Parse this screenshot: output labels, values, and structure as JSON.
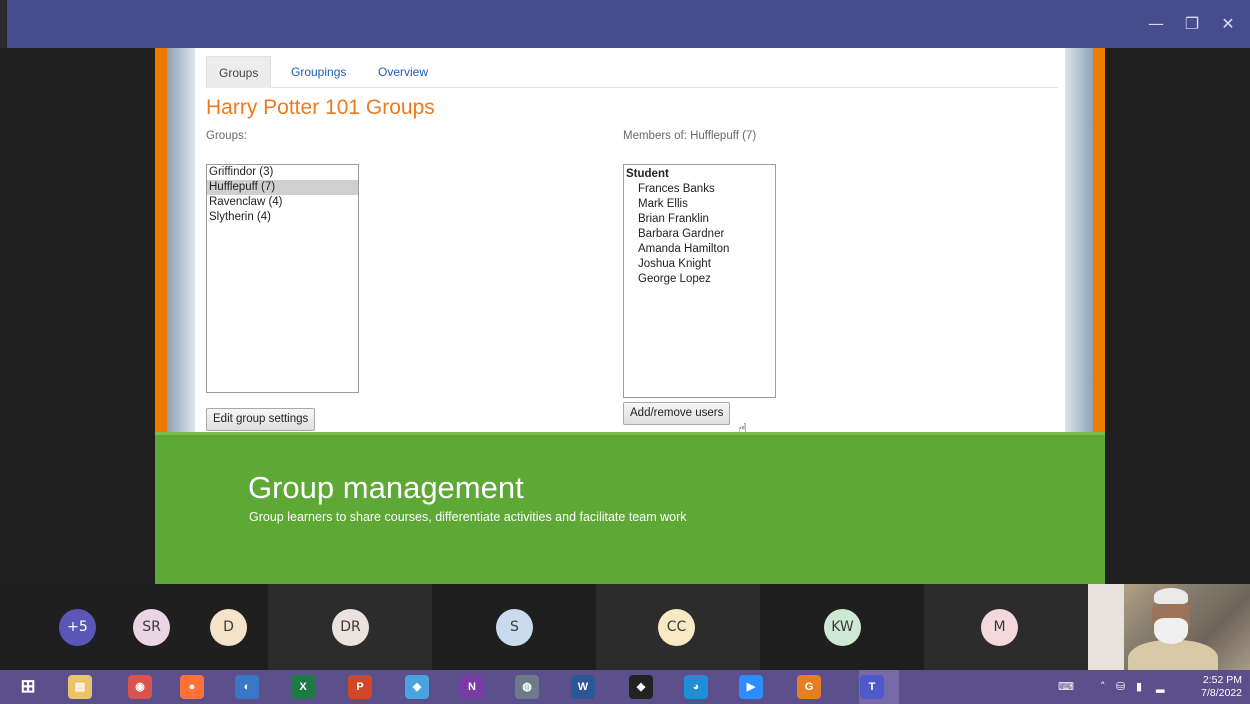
{
  "window": {
    "minimize_glyph": "—",
    "maximize_glyph": "❐",
    "close_glyph": "✕"
  },
  "moodle": {
    "tabs": [
      "Groups",
      "Groupings",
      "Overview"
    ],
    "active_tab": "Groups",
    "page_title": "Harry Potter 101 Groups",
    "groups_label": "Groups:",
    "groups": [
      {
        "label": "Griffindor (3)",
        "selected": false
      },
      {
        "label": "Hufflepuff (7)",
        "selected": true
      },
      {
        "label": "Ravenclaw (4)",
        "selected": false
      },
      {
        "label": "Slytherin (4)",
        "selected": false
      }
    ],
    "members_label": "Members of: Hufflepuff (7)",
    "member_role": "Student",
    "members": [
      "Frances Banks",
      "Mark Ellis",
      "Brian Franklin",
      "Barbara Gardner",
      "Amanda Hamilton",
      "Joshua Knight",
      "George Lopez"
    ],
    "edit_group_button": "Edit group settings",
    "add_remove_button": "Add/remove users"
  },
  "slide": {
    "title": "Group management",
    "subtitle": "Group learners to share courses, differentiate activities and facilitate team work"
  },
  "participants": [
    {
      "initials": "+5",
      "color": "#5a57b8",
      "text_color": "#ffffff"
    },
    {
      "initials": "SR",
      "color": "#ead5e6",
      "text_color": "#3a3a3a"
    },
    {
      "initials": "D",
      "color": "#f4e3c9",
      "text_color": "#3a3a3a"
    },
    {
      "initials": "DR",
      "color": "#ece2dd",
      "text_color": "#3a3a3a"
    },
    {
      "initials": "S",
      "color": "#c9dbef",
      "text_color": "#3a3a3a"
    },
    {
      "initials": "CC",
      "color": "#f6e9c3",
      "text_color": "#3a3a3a"
    },
    {
      "initials": "KW",
      "color": "#cfe8d4",
      "text_color": "#3a3a3a"
    },
    {
      "initials": "M",
      "color": "#f3d8dc",
      "text_color": "#3a3a3a"
    }
  ],
  "taskbar": {
    "apps": [
      {
        "name": "file-explorer-icon",
        "glyph": "▤",
        "color": "#e9c46a"
      },
      {
        "name": "chrome-icon",
        "glyph": "◉",
        "color": "#d9534f"
      },
      {
        "name": "firefox-icon",
        "glyph": "●",
        "color": "#ff7139"
      },
      {
        "name": "media-player-icon",
        "glyph": "◐",
        "color": "#3b77c9"
      },
      {
        "name": "excel-icon",
        "glyph": "X",
        "color": "#1d7a45"
      },
      {
        "name": "powerpoint-icon",
        "glyph": "P",
        "color": "#d24726"
      },
      {
        "name": "notes-icon",
        "glyph": "◆",
        "color": "#4aa3df"
      },
      {
        "name": "onenote-icon",
        "glyph": "N",
        "color": "#7a3aa6"
      },
      {
        "name": "browser-icon",
        "glyph": "◍",
        "color": "#6c7a89"
      },
      {
        "name": "word-icon",
        "glyph": "W",
        "color": "#2b5797"
      },
      {
        "name": "inkscape-icon",
        "glyph": "◆",
        "color": "#222222"
      },
      {
        "name": "edge-icon",
        "glyph": "◕",
        "color": "#1e8fd6"
      },
      {
        "name": "zoom-icon",
        "glyph": "▶",
        "color": "#2d8cff"
      },
      {
        "name": "pdf-icon",
        "glyph": "G",
        "color": "#e67e22"
      },
      {
        "name": "teams-icon",
        "glyph": "T",
        "color": "#5059c9"
      }
    ],
    "clock_time": "2:52 PM",
    "clock_date": "7/8/2022"
  }
}
